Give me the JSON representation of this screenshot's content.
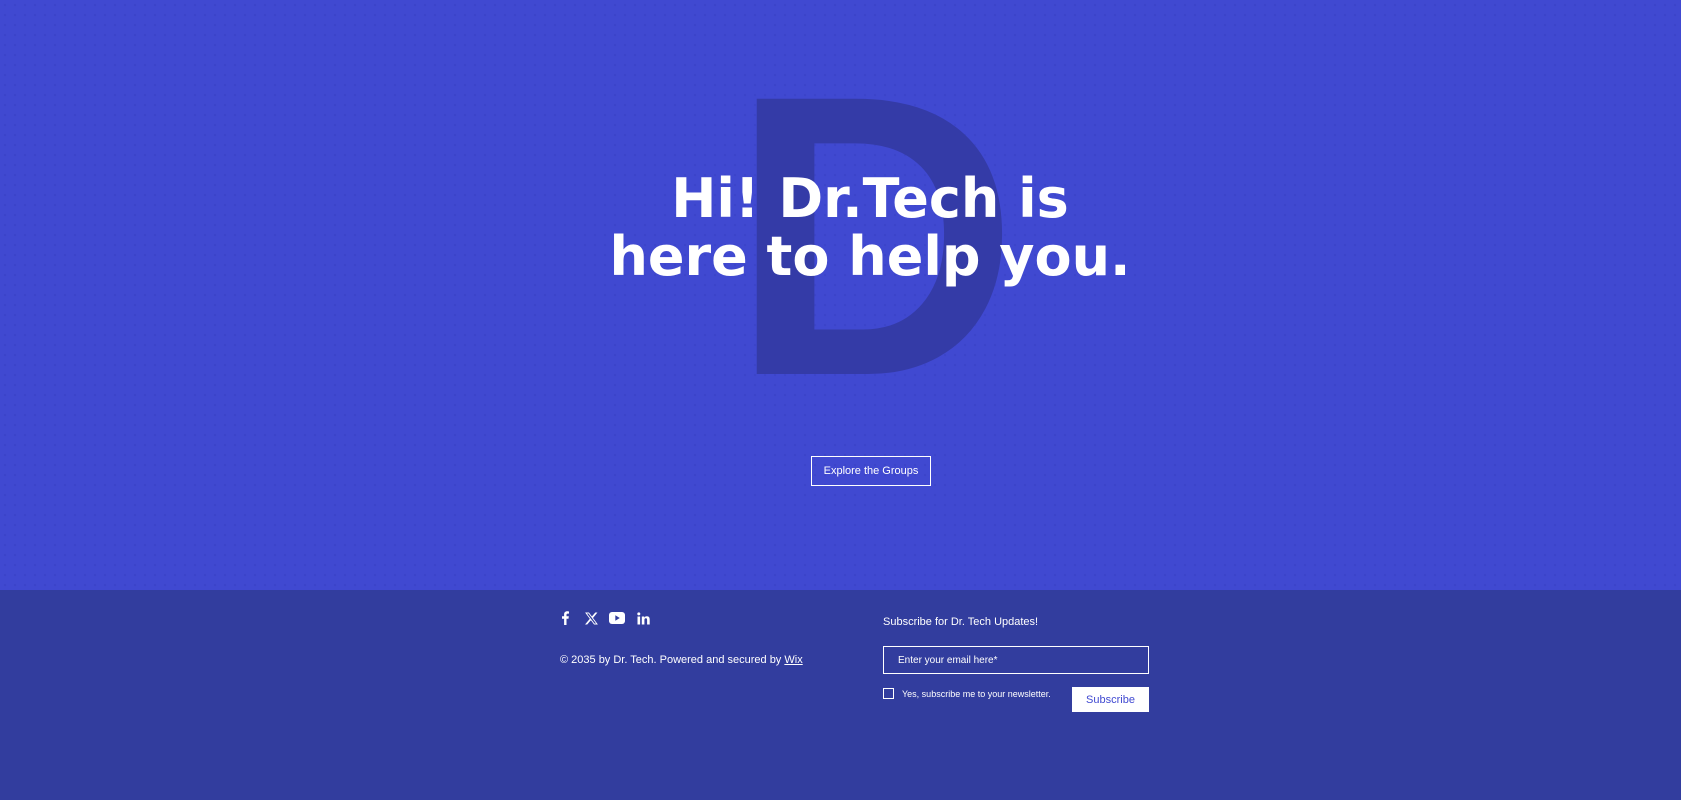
{
  "colors": {
    "hero_bg": "#4049d1",
    "footer_bg": "#323d9e",
    "watermark": "#3339a0",
    "text": "#ffffff"
  },
  "hero": {
    "watermark_letter": "D",
    "headline_line1": "Hi! Dr.Tech is",
    "headline_line2": "here to help you.",
    "cta_label": "Explore the Groups"
  },
  "footer": {
    "social_icons": [
      "facebook-icon",
      "x-icon",
      "youtube-icon",
      "linkedin-icon"
    ],
    "copyright_text": "© 2035 by Dr. Tech. Powered and secured by ",
    "copyright_link": "Wix",
    "subscribe_title": "Subscribe for Dr. Tech Updates!",
    "email_placeholder": "Enter your email here*",
    "newsletter_label": "Yes, subscribe me to your newsletter.",
    "subscribe_label": "Subscribe"
  }
}
